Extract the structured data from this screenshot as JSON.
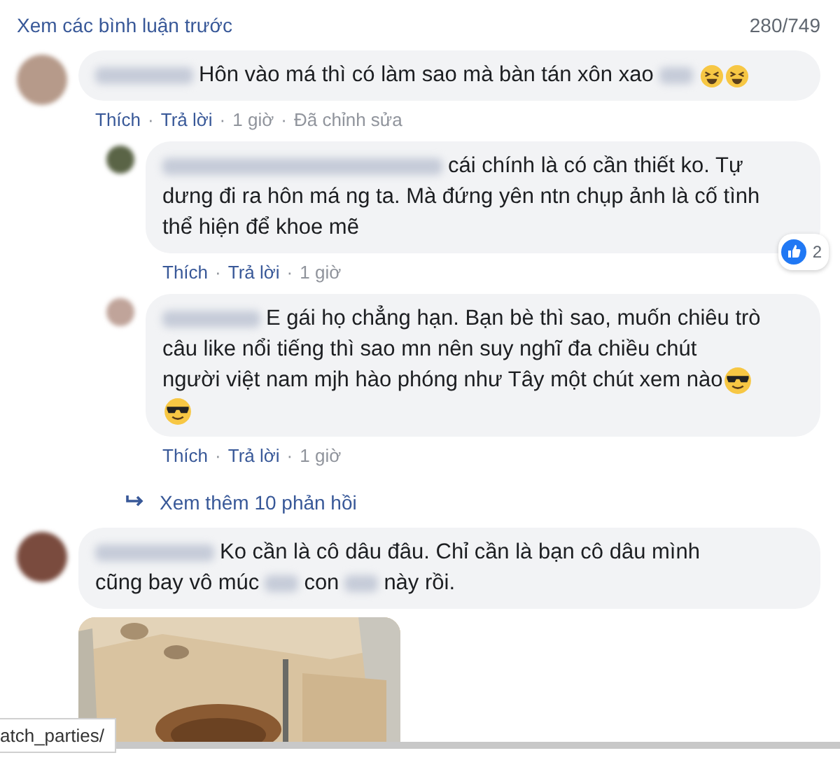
{
  "header": {
    "link": "Xem các bình luận trước",
    "count": "280/749"
  },
  "separator": "·",
  "threads": [
    {
      "comment": {
        "lines": [
          [
            {
              "kind": "name"
            },
            {
              "kind": "text",
              "text": "Hôn vào má thì có làm sao mà bàn tán xôn xao"
            },
            {
              "kind": "blur"
            },
            {
              "kind": "laugh"
            },
            {
              "kind": "laugh"
            }
          ]
        ],
        "actions": [
          "Thích",
          "Trả lời",
          "1 giờ",
          "Đã chỉnh sửa"
        ]
      },
      "replies": [
        {
          "lines": [
            [
              {
                "kind": "name"
              },
              {
                "kind": "text",
                "text": "cái chính là có cần thiết ko. Tự"
              }
            ],
            [
              {
                "kind": "text",
                "text": "dưng đi ra hôn má ng ta. Mà đứng yên ntn chụp ảnh là cố tình"
              }
            ],
            [
              {
                "kind": "text",
                "text": "thể hiện để khoe mẽ"
              }
            ]
          ],
          "actions": [
            "Thích",
            "Trả lời",
            "1 giờ"
          ],
          "reactions": "2"
        },
        {
          "lines": [
            [
              {
                "kind": "name"
              },
              {
                "kind": "text",
                "text": "E gái họ chẳng hạn. Bạn bè thì sao, muốn chiêu trò"
              }
            ],
            [
              {
                "kind": "text",
                "text": "câu like nổi tiếng thì sao mn nên suy nghĩ đa chiều chút"
              }
            ],
            [
              {
                "kind": "text",
                "text": "người việt nam mjh hào phóng như Tây một chút xem nào"
              },
              {
                "kind": "cool"
              }
            ],
            [
              {
                "kind": "cool"
              }
            ]
          ],
          "actions": [
            "Thích",
            "Trả lời",
            "1 giờ"
          ]
        }
      ],
      "more_replies": "Xem thêm 10 phản hồi"
    },
    {
      "comment": {
        "lines": [
          [
            {
              "kind": "name"
            },
            {
              "kind": "text",
              "text": "Ko cần là cô dâu đâu. Chỉ cần là bạn cô dâu mình"
            }
          ],
          [
            {
              "kind": "text",
              "text": "cũng bay vô múc"
            },
            {
              "kind": "blur"
            },
            {
              "kind": "text",
              "text": "con"
            },
            {
              "kind": "blur"
            },
            {
              "kind": "text",
              "text": "này rồi."
            }
          ]
        ],
        "attachment": {
          "kind": "picture"
        }
      }
    }
  ],
  "status_url": "atch_parties/"
}
